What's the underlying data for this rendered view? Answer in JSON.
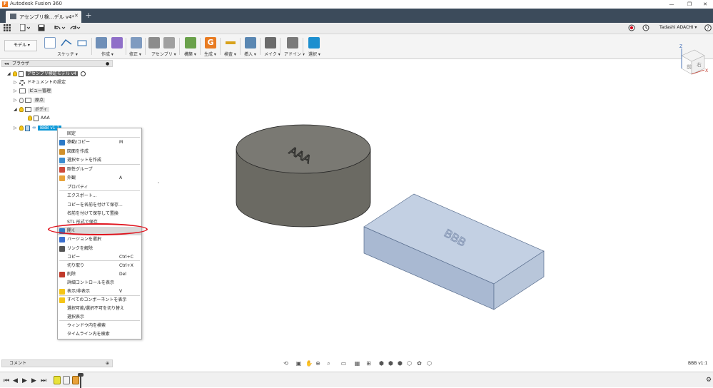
{
  "titlebar": {
    "title": "Autodesk Fusion 360",
    "minimize": "—",
    "restore": "❐",
    "close": "✕"
  },
  "tab": {
    "label": "アセンブリ検…デル v4*",
    "close": "✕",
    "new": "+"
  },
  "quickaccess": {
    "user": "Tadashi ADACHI ▾",
    "help": "?"
  },
  "toolbar": {
    "workspace": "モデル ▾",
    "groups": [
      {
        "label": "スケッチ ▾",
        "color": "#7a9cc6"
      },
      {
        "label": "作成 ▾",
        "color": "#6f8fb8"
      },
      {
        "label": "修正 ▾",
        "color": "#7f9bc0"
      },
      {
        "label": "アセンブリ ▾",
        "color": "#8c8c8c"
      },
      {
        "label": "構築 ▾",
        "color": "#6aa14b"
      },
      {
        "label": "生成 ▾",
        "color": "#e87b22"
      },
      {
        "label": "検査 ▾",
        "color": "#d8a21c"
      },
      {
        "label": "挿入 ▾",
        "color": "#5a87b2"
      },
      {
        "label": "メイク ▾",
        "color": "#6b6b6b"
      },
      {
        "label": "アドイン ▾",
        "color": "#7a7a7a"
      },
      {
        "label": "選択 ▾",
        "color": "#1d8fcf"
      }
    ]
  },
  "browser": {
    "title": "ブラウザ",
    "nodes": [
      {
        "label": "アセンブリ検証モデル v4"
      },
      {
        "label": "ドキュメントの設定"
      },
      {
        "label": "ビュー管理"
      },
      {
        "label": "原点"
      },
      {
        "label": "ボディ"
      },
      {
        "label": "AAA"
      },
      {
        "label": "BBB v1:1"
      }
    ]
  },
  "context_menu": {
    "items": [
      {
        "label": "固定",
        "key": ""
      },
      {
        "label": "移動/コピー",
        "key": "M"
      },
      {
        "label": "図面を作成",
        "key": ""
      },
      {
        "label": "選択セットを作成",
        "key": ""
      },
      {
        "label": "剛性グループ",
        "key": ""
      },
      {
        "label": "外観",
        "key": "A"
      },
      {
        "label": "プロパティ",
        "key": ""
      },
      {
        "label": "エクスポート...",
        "key": ""
      },
      {
        "label": "コピーを名前を付けて保存...",
        "key": ""
      },
      {
        "label": "名前を付けて保存して置換",
        "key": ""
      },
      {
        "label": "STL 形式で保存",
        "key": ""
      },
      {
        "label": "開く",
        "key": ""
      },
      {
        "label": "バージョンを選択",
        "key": ""
      },
      {
        "label": "リンクを解除",
        "key": ""
      },
      {
        "label": "コピー",
        "key": "Ctrl+C"
      },
      {
        "label": "切り取り",
        "key": "Ctrl+X"
      },
      {
        "label": "削除",
        "key": "Del"
      },
      {
        "label": "詳細コントロールを表示",
        "key": ""
      },
      {
        "label": "表示/非表示",
        "key": "V"
      },
      {
        "label": "すべてのコンポーネントを表示",
        "key": ""
      },
      {
        "label": "選択可能/選択不可を切り替え",
        "key": ""
      },
      {
        "label": "選択表示",
        "key": ""
      },
      {
        "label": "ウィンドウ内を検索",
        "key": ""
      },
      {
        "label": "タイムライン内を検索",
        "key": ""
      }
    ]
  },
  "viewport": {
    "cylinder_text": "AAA",
    "box_text": "BBB",
    "viewcube": {
      "front": "前",
      "right": "右",
      "axis_z": "Z",
      "axis_x": "X"
    }
  },
  "comments": {
    "label": "コメント"
  },
  "status": {
    "selection": "BBB v1:1"
  },
  "colors": {
    "tab_bar": "#3c4b5b",
    "selection_blue": "#0696d7",
    "highlight_red": "#e0141e",
    "box_fill": "#b8c6da",
    "cylinder_fill": "#6b6a63"
  }
}
